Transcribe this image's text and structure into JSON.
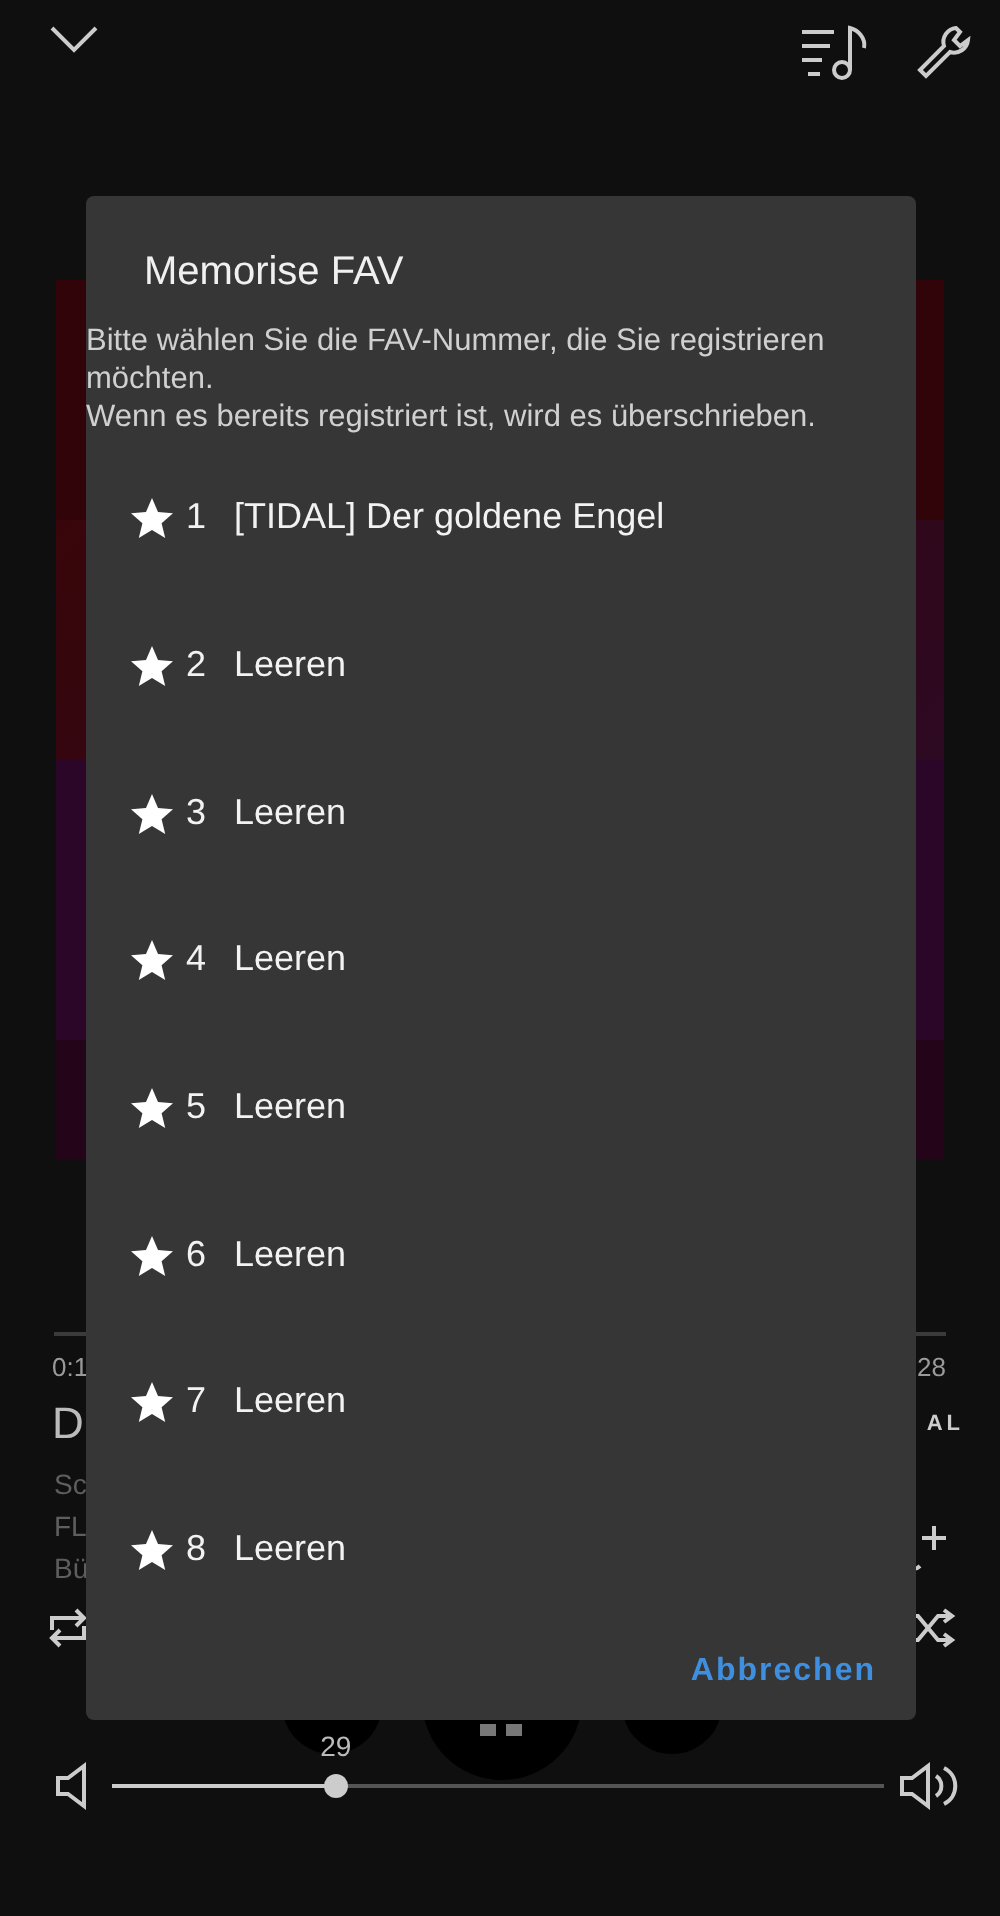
{
  "now_playing": {
    "elapsed": "0:1",
    "duration": "28",
    "title": "D",
    "source": "AL",
    "info_lines": [
      "Sc",
      "FL",
      "Bü"
    ]
  },
  "volume": {
    "reading": "29",
    "level": 0.29
  },
  "dialog": {
    "title": "Memorise FAV",
    "message": [
      "Bitte wählen Sie die FAV-Nummer, die Sie registrieren möchten.",
      "Wenn es bereits registriert ist, wird es überschrieben."
    ],
    "items": [
      {
        "number": "1",
        "label": "[TIDAL] Der goldene Engel"
      },
      {
        "number": "2",
        "label": "Leeren"
      },
      {
        "number": "3",
        "label": "Leeren"
      },
      {
        "number": "4",
        "label": "Leeren"
      },
      {
        "number": "5",
        "label": "Leeren"
      },
      {
        "number": "6",
        "label": "Leeren"
      },
      {
        "number": "7",
        "label": "Leeren"
      },
      {
        "number": "8",
        "label": "Leeren"
      }
    ],
    "cancel": "Abbrechen"
  }
}
